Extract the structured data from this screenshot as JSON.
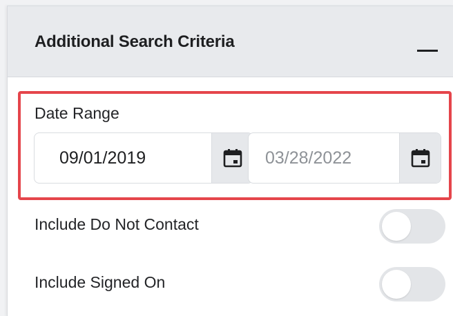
{
  "panel": {
    "title": "Additional Search Criteria",
    "collapse_icon": "minus-icon"
  },
  "date_range": {
    "label": "Date Range",
    "start_value": "09/01/2019",
    "end_placeholder": "03/28/2022",
    "calendar_icon": "calendar-icon",
    "highlight_color": "#e5454b"
  },
  "toggles": [
    {
      "label": "Include Do Not Contact",
      "on": false
    },
    {
      "label": "Include Signed On",
      "on": false
    }
  ]
}
